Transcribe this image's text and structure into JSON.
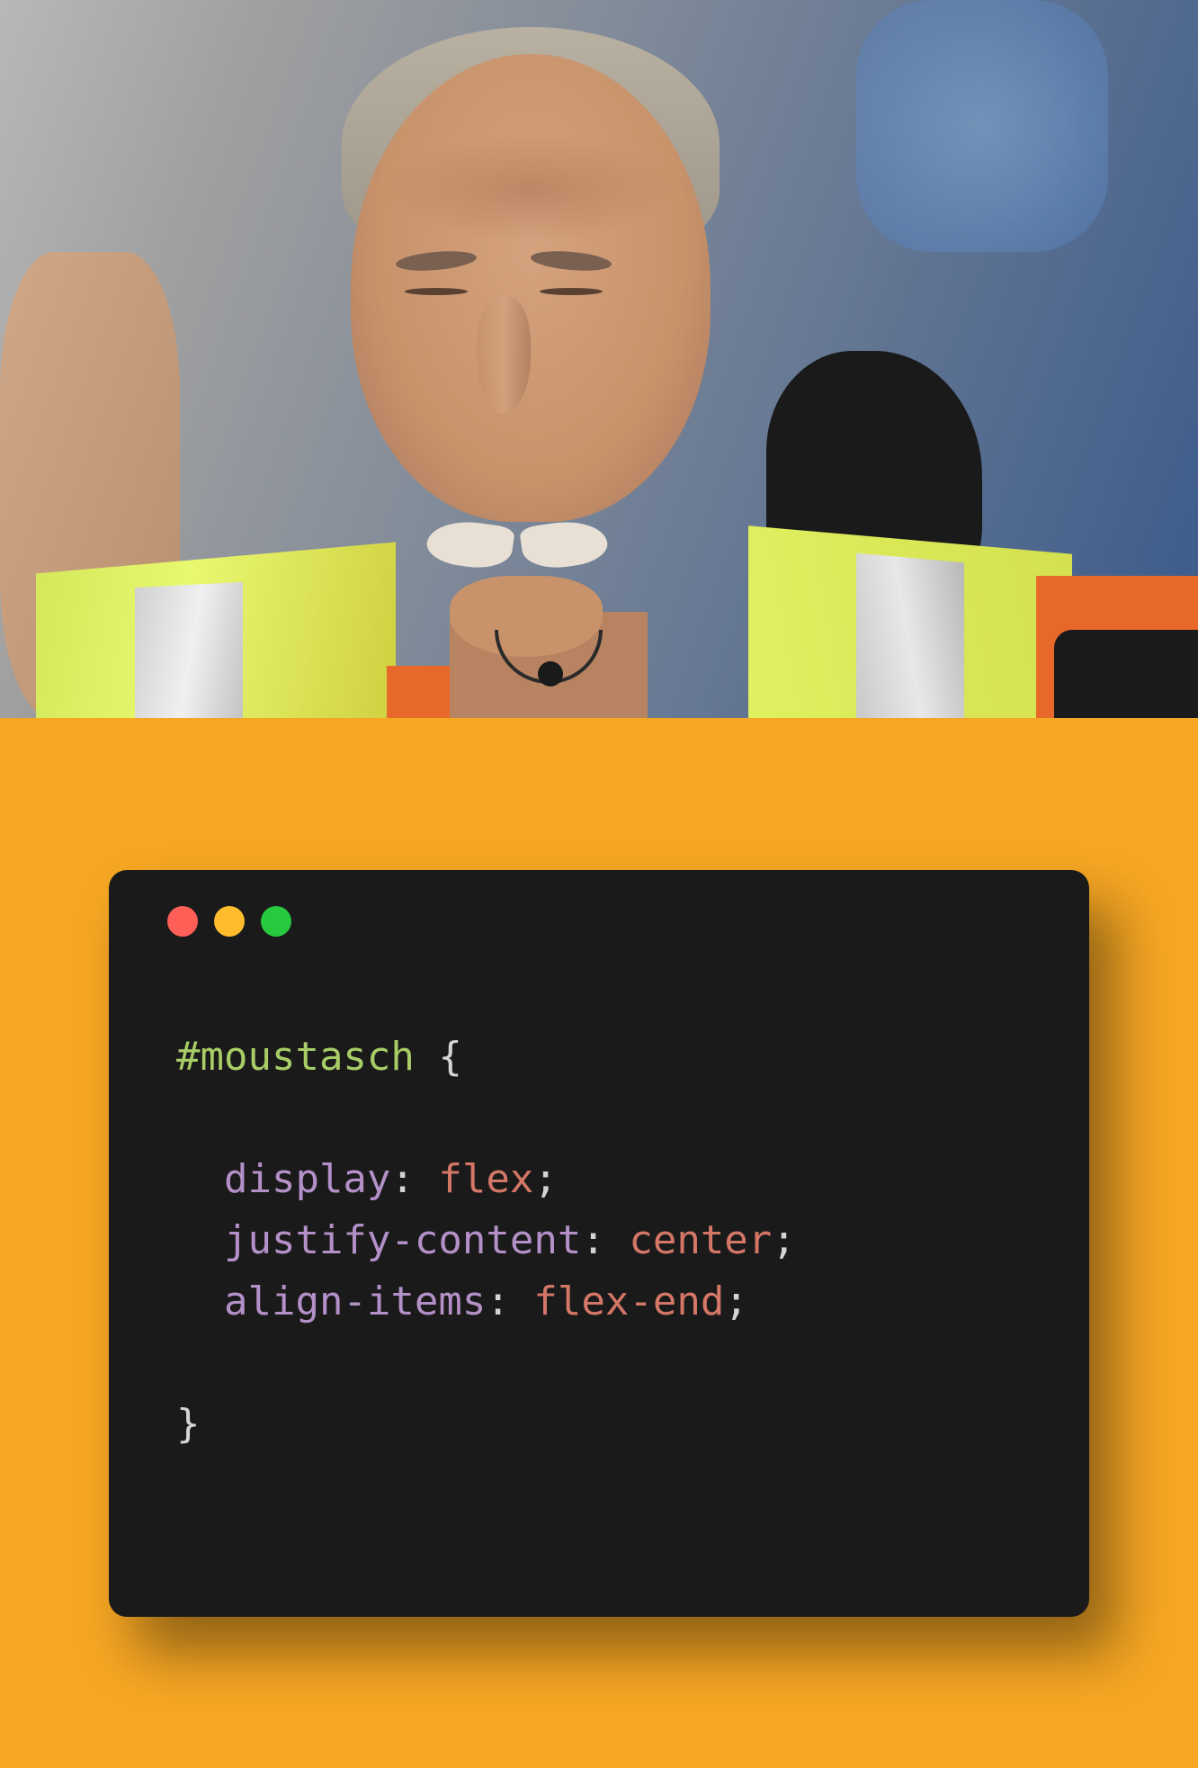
{
  "code": {
    "selector": "#moustasch",
    "open_brace": "{",
    "close_brace": "}",
    "rules": [
      {
        "property": "display",
        "value": "flex"
      },
      {
        "property": "justify-content",
        "value": "center"
      },
      {
        "property": "align-items",
        "value": "flex-end"
      }
    ]
  },
  "colors": {
    "background_panel": "#f5a623",
    "code_bg": "#1a1a1a",
    "dot_red": "#ff5f56",
    "dot_yellow": "#ffbd2e",
    "dot_green": "#27c93f",
    "selector_color": "#a8cc66",
    "property_color": "#b490c8",
    "value_color": "#d47767"
  }
}
